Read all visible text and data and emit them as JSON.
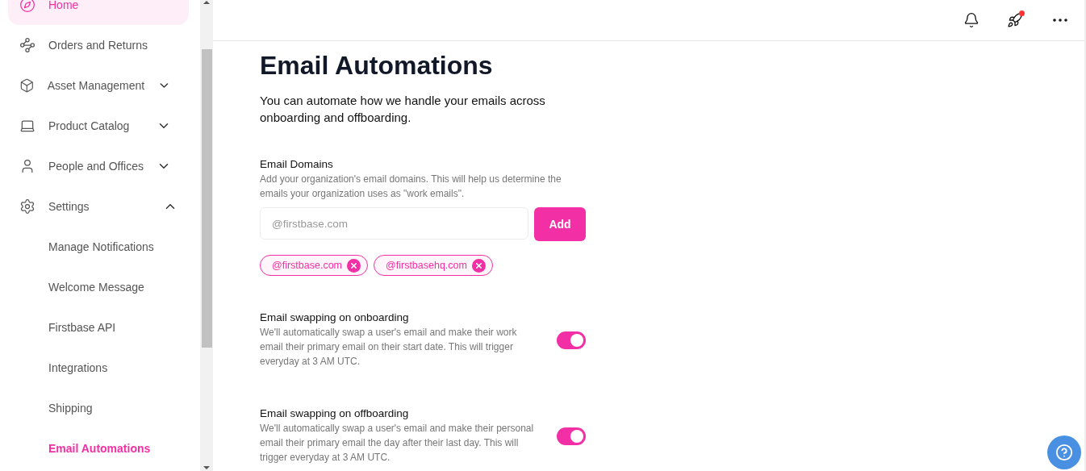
{
  "sidebar": {
    "items": [
      {
        "label": "Home",
        "selected": true
      },
      {
        "label": "Orders and Returns",
        "selected": false
      },
      {
        "label": "Asset Management",
        "selected": false,
        "expanded": false
      },
      {
        "label": "Product Catalog",
        "selected": false,
        "expanded": false
      },
      {
        "label": "People and Offices",
        "selected": false,
        "expanded": false
      },
      {
        "label": "Settings",
        "selected": false,
        "expanded": true,
        "children": [
          {
            "label": "Manage Notifications",
            "selected": false
          },
          {
            "label": "Welcome Message",
            "selected": false
          },
          {
            "label": "Firstbase API",
            "selected": false
          },
          {
            "label": "Integrations",
            "selected": false
          },
          {
            "label": "Shipping",
            "selected": false
          },
          {
            "label": "Email Automations",
            "selected": true
          }
        ]
      }
    ]
  },
  "page": {
    "title": "Email Automations",
    "subtitle": "You can automate how we handle your emails across onboarding and offboarding.",
    "domains": {
      "label": "Email Domains",
      "description": "Add your organization's email domains. This will help us determine the emails your organization uses as \"work emails\".",
      "placeholder": "@firstbase.com",
      "button": "Add",
      "tags": [
        "@firstbase.com",
        "@firstbasehq.com"
      ]
    },
    "settings": [
      {
        "label": "Email swapping on onboarding",
        "description": "We'll automatically swap a user's email and make their work email their primary email on their start date. This will trigger everyday at 3 AM UTC.",
        "on": true
      },
      {
        "label": "Email swapping on offboarding",
        "description": "We'll automatically swap a user's email and make their personal email their primary email the day after their last day. This will trigger everyday at 3 AM UTC.",
        "on": true
      }
    ]
  }
}
